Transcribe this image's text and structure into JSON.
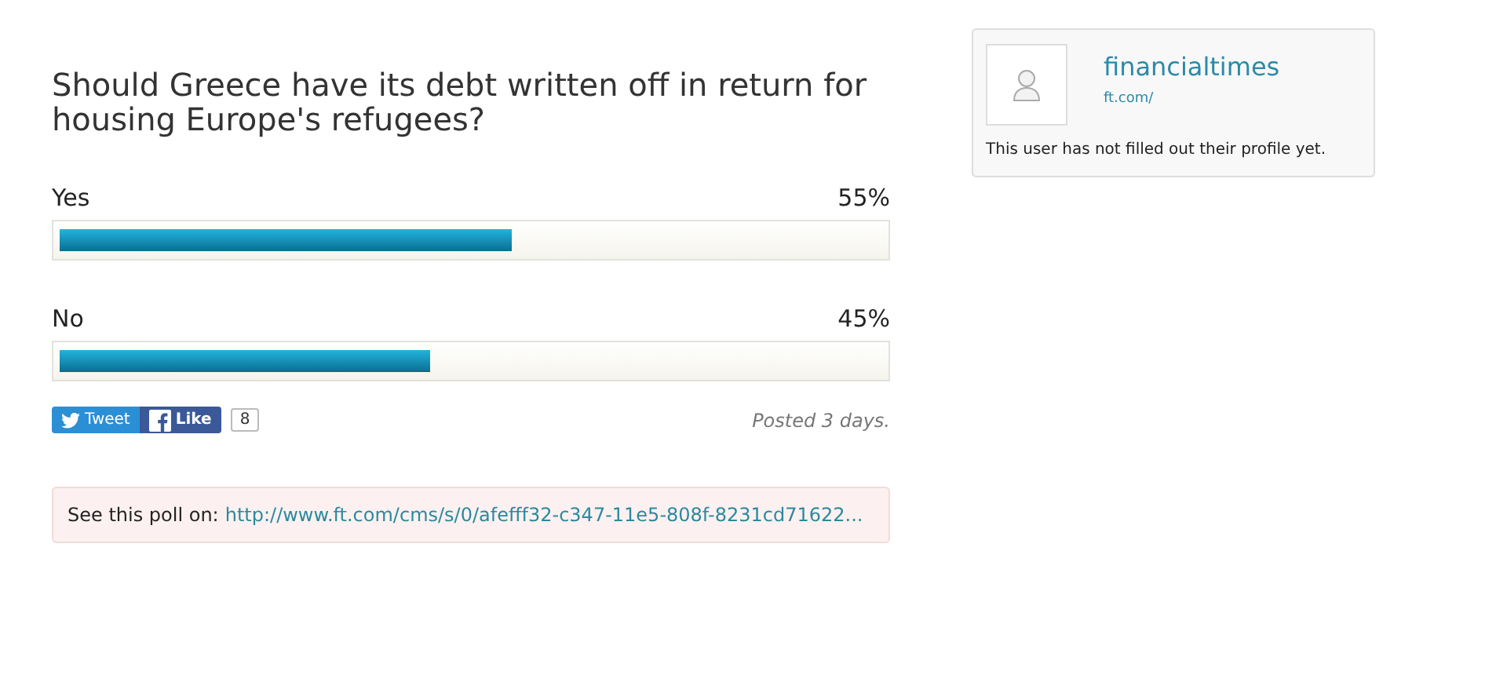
{
  "poll": {
    "question": "Should Greece have its debt written off in return for housing Europe's refugees?",
    "options": [
      {
        "label": "Yes",
        "percent": "55%",
        "level": 0.55
      },
      {
        "label": "No",
        "percent": "45%",
        "level": 0.45
      }
    ],
    "share": {
      "tweet": "Tweet",
      "like": "Like",
      "like_count": "8"
    },
    "posted": "Posted 3 days.",
    "source": {
      "label": "See this poll on:",
      "link": "http://www.ft.com/cms/s/0/afefff32-c347-11e5-808f-8231cd71622..."
    }
  },
  "profile": {
    "name": "financialtimes",
    "url": "ft.com/",
    "bio": "This user has not filled out their profile yet."
  }
}
